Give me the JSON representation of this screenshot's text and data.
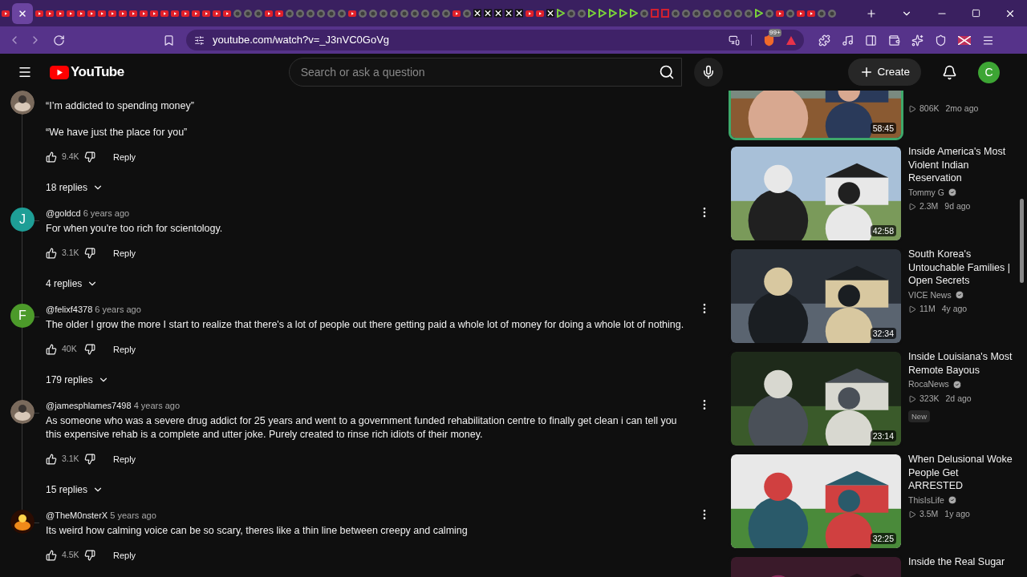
{
  "browser": {
    "tabs": [
      {
        "kind": "video",
        "selected": false
      },
      {
        "selected": true
      },
      {
        "kind": "video",
        "selected": false
      },
      {
        "kind": "video",
        "selected": false
      },
      {
        "kind": "video",
        "selected": false
      },
      {
        "kind": "video",
        "selected": false
      },
      {
        "kind": "video",
        "selected": false
      },
      {
        "kind": "video",
        "selected": false
      },
      {
        "kind": "video",
        "selected": false
      },
      {
        "kind": "video",
        "selected": false
      },
      {
        "kind": "video",
        "selected": false
      },
      {
        "kind": "video",
        "selected": false
      },
      {
        "kind": "video",
        "selected": false
      },
      {
        "kind": "video",
        "selected": false
      },
      {
        "kind": "video",
        "selected": false
      },
      {
        "kind": "video",
        "selected": false
      },
      {
        "kind": "video",
        "selected": false
      },
      {
        "kind": "video",
        "selected": false
      },
      {
        "kind": "video",
        "selected": false
      },
      {
        "kind": "video",
        "selected": false
      },
      {
        "kind": "video",
        "selected": false
      },
      {
        "kind": "globe",
        "selected": false
      },
      {
        "kind": "globe",
        "selected": false
      },
      {
        "kind": "globe",
        "selected": false
      },
      {
        "kind": "video",
        "selected": false
      },
      {
        "kind": "video",
        "selected": false
      },
      {
        "kind": "globe",
        "selected": false
      },
      {
        "kind": "globe",
        "selected": false
      },
      {
        "kind": "globe",
        "selected": false
      },
      {
        "kind": "globe",
        "selected": false
      },
      {
        "kind": "globe",
        "selected": false
      },
      {
        "kind": "globe",
        "selected": false
      },
      {
        "kind": "video",
        "selected": false
      },
      {
        "kind": "globe",
        "selected": false
      },
      {
        "kind": "globe",
        "selected": false
      },
      {
        "kind": "globe",
        "selected": false
      },
      {
        "kind": "globe",
        "selected": false
      },
      {
        "kind": "globe",
        "selected": false
      },
      {
        "kind": "globe",
        "selected": false
      },
      {
        "kind": "globe",
        "selected": false
      },
      {
        "kind": "globe",
        "selected": false
      },
      {
        "kind": "globe",
        "selected": false
      },
      {
        "kind": "video",
        "selected": false
      },
      {
        "kind": "globe",
        "selected": false
      },
      {
        "kind": "x",
        "selected": false
      },
      {
        "kind": "x",
        "selected": false
      },
      {
        "kind": "x",
        "selected": false
      },
      {
        "kind": "x",
        "selected": false
      },
      {
        "kind": "x",
        "selected": false
      },
      {
        "kind": "video",
        "selected": false
      },
      {
        "kind": "video",
        "selected": false
      },
      {
        "kind": "x",
        "selected": false
      },
      {
        "kind": "d",
        "selected": false
      },
      {
        "kind": "globe",
        "selected": false
      },
      {
        "kind": "globe",
        "selected": false
      },
      {
        "kind": "d",
        "selected": false
      },
      {
        "kind": "d",
        "selected": false
      },
      {
        "kind": "d",
        "selected": false
      },
      {
        "kind": "d",
        "selected": false
      },
      {
        "kind": "d",
        "selected": false
      },
      {
        "kind": "globe",
        "selected": false
      },
      {
        "kind": "c",
        "selected": false
      },
      {
        "kind": "c",
        "selected": false
      },
      {
        "kind": "globe",
        "selected": false
      },
      {
        "kind": "globe",
        "selected": false
      },
      {
        "kind": "globe",
        "selected": false
      },
      {
        "kind": "globe",
        "selected": false
      },
      {
        "kind": "globe",
        "selected": false
      },
      {
        "kind": "globe",
        "selected": false
      },
      {
        "kind": "globe",
        "selected": false
      },
      {
        "kind": "globe",
        "selected": false
      },
      {
        "kind": "d",
        "selected": false
      },
      {
        "kind": "globe",
        "selected": false
      },
      {
        "kind": "video",
        "selected": false
      },
      {
        "kind": "globe",
        "selected": false
      },
      {
        "kind": "video",
        "selected": false
      },
      {
        "kind": "video",
        "selected": false
      },
      {
        "kind": "globe",
        "selected": false
      },
      {
        "kind": "globe",
        "selected": false
      }
    ],
    "url": "youtube.com/watch?v=_J3nVC0GoVg",
    "shield_badge": "99+"
  },
  "header": {
    "logo_text": "YouTube",
    "search": {
      "placeholder": "Search or ask a question"
    },
    "create_label": "Create",
    "account_letter": "C"
  },
  "comments": [
    {
      "avatar": {
        "kind": "picture"
      },
      "text": [
        "“I’m addicted to spending money”",
        "“We have just the place for you”"
      ],
      "likes": "9.4K",
      "reply_label": "Reply",
      "replies": "18 replies"
    },
    {
      "author": "@goldcd",
      "time": "6 years ago",
      "avatar": {
        "kind": "letter",
        "letter": "J",
        "color": "#1e9e96"
      },
      "text": [
        "For when you're too rich for scientology."
      ],
      "likes": "3.1K",
      "reply_label": "Reply",
      "replies": "4 replies"
    },
    {
      "author": "@felixf4378",
      "time": "6 years ago",
      "avatar": {
        "kind": "letter",
        "letter": "F",
        "color": "#4c9a2a"
      },
      "text": [
        "The older I grow the more I start to realize that there's a lot of people out there getting paid a whole lot of money for doing a whole lot of nothing."
      ],
      "likes": "40K",
      "reply_label": "Reply",
      "replies": "179 replies"
    },
    {
      "author": "@jamesphlames7498",
      "time": "4 years ago",
      "avatar": {
        "kind": "picture"
      },
      "text": [
        "As someone who was a severe drug addict for 25 years and went to a government funded rehabilitation centre to finally get clean i can tell you this expensive rehab is a complete and utter joke. Purely created to rinse rich idiots of their money."
      ],
      "likes": "3.1K",
      "reply_label": "Reply",
      "replies": "15 replies"
    },
    {
      "author": "@TheM0nsterX",
      "time": "5 years ago",
      "avatar": {
        "kind": "picture"
      },
      "text": [
        "Its weird how calming voice can be so scary, theres like a thin line between creepy and calming"
      ],
      "likes": "4.5K",
      "reply_label": "Reply"
    }
  ],
  "related": [
    {
      "outlined": true,
      "duration": "58:45",
      "views": "806K",
      "age": "2mo ago"
    },
    {
      "outlined": false,
      "duration": "42:58",
      "title": "Inside America's Most Violent Indian Reservation",
      "channel": "Tommy G",
      "verified": true,
      "views": "2.3M",
      "age": "9d ago"
    },
    {
      "outlined": false,
      "duration": "32:34",
      "title": "South Korea's Untouchable Families | Open Secrets",
      "channel": "VICE News",
      "verified": true,
      "views": "11M",
      "age": "4y ago"
    },
    {
      "outlined": false,
      "duration": "23:14",
      "title": "Inside Louisiana's Most Remote Bayous",
      "channel": "RocaNews",
      "verified": true,
      "views": "323K",
      "age": "2d ago",
      "badge": "New"
    },
    {
      "outlined": false,
      "duration": "32:25",
      "title": "When Delusional Woke People Get ARRESTED",
      "channel": "ThisIsLife",
      "verified": true,
      "views": "3.5M",
      "age": "1y ago"
    },
    {
      "outlined": false,
      "title": "Inside the Real Sugar"
    }
  ]
}
